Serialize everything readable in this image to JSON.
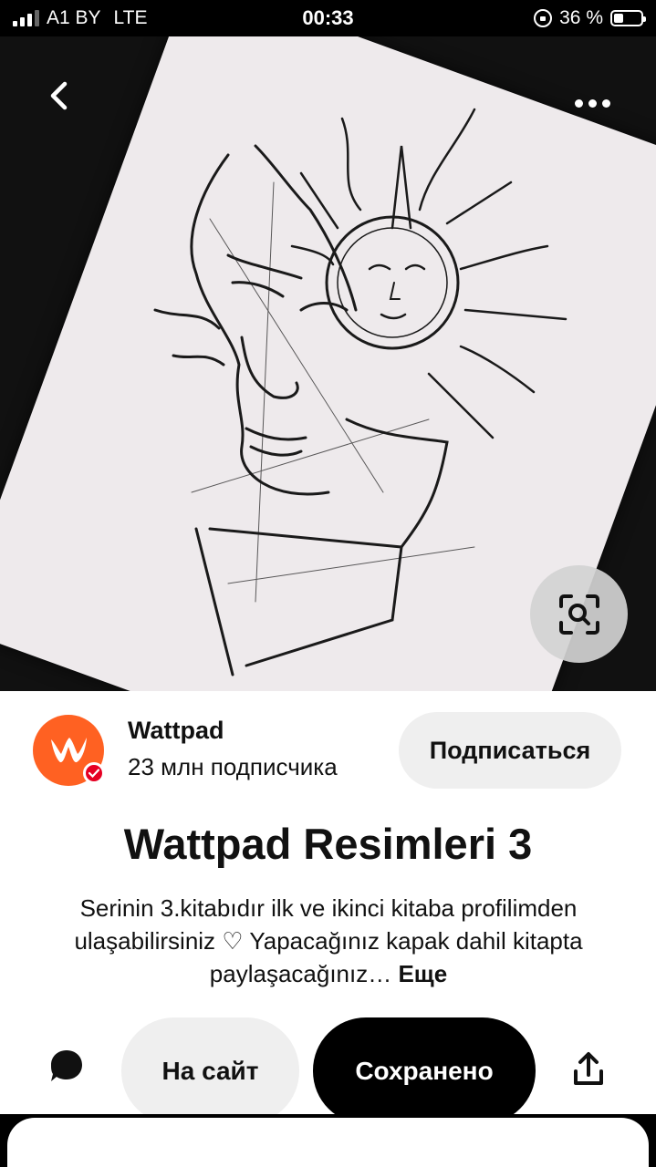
{
  "status_bar": {
    "carrier": "A1 BY",
    "network": "LTE",
    "time": "00:33",
    "battery": "36 %",
    "battery_level": 0.36
  },
  "image": {
    "description_icon": "sketch-artwork"
  },
  "creator": {
    "name": "Wattpad",
    "followers": "23 млн подписчика",
    "follow_label": "Подписаться",
    "avatar_color": "#ff6122"
  },
  "pin": {
    "title": "Wattpad Resimleri 3",
    "description": "Serinin 3.kitabıdır ilk ve ikinci kitaba profilimden ulaşabilirsiniz ♡ Yapacağınız kapak dahil kitapta paylaşacağınız…",
    "more_label": "Еще"
  },
  "actions": {
    "site_label": "На сайт",
    "saved_label": "Сохранено"
  },
  "colors": {
    "accent": "#e60023",
    "saved_bg": "#000000",
    "secondary_bg": "#efefef"
  }
}
